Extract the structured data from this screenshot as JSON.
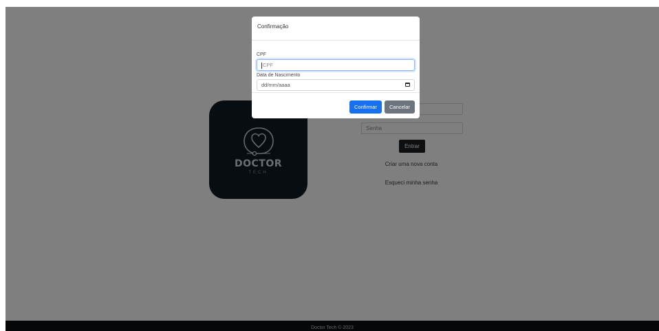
{
  "brand": {
    "name": "DOCTOR",
    "sub": "TECH"
  },
  "login": {
    "password_placeholder": "Senha",
    "enter_label": "Entrar",
    "create_account": "Criar uma nova conta",
    "forgot_password": "Esqueci minha senha"
  },
  "footer": {
    "text": "Doctor Tech © 2023"
  },
  "modal": {
    "title": "Confirmação",
    "cpf_label": "CPF",
    "cpf_placeholder": "CPF",
    "birth_label": "Data de Nascimento",
    "birth_placeholder": "dd/mm/aaaa",
    "confirm_label": "Confirmar",
    "cancel_label": "Cancelar"
  },
  "colors": {
    "logo_bg": "#0f1a22",
    "confirm": "#1670f0",
    "cancel": "#6c757d",
    "footer": "#0d0f12"
  }
}
